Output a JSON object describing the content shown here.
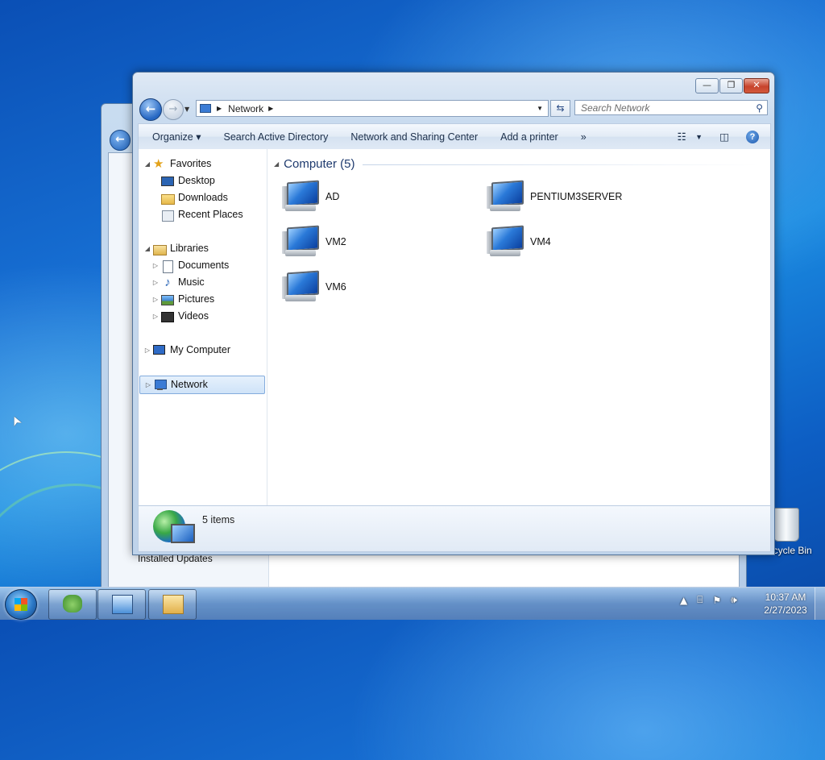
{
  "window": {
    "address": {
      "location": "Network"
    },
    "search": {
      "placeholder": "Search Network"
    }
  },
  "toolbar": {
    "organize": "Organize",
    "search_ad": "Search Active Directory",
    "network_center": "Network and Sharing Center",
    "add_printer": "Add a printer",
    "more": "»"
  },
  "navpane": {
    "favorites": "Favorites",
    "desktop": "Desktop",
    "downloads": "Downloads",
    "recent_places": "Recent Places",
    "libraries": "Libraries",
    "documents": "Documents",
    "music": "Music",
    "pictures": "Pictures",
    "videos": "Videos",
    "my_computer": "My Computer",
    "network": "Network"
  },
  "main": {
    "group_header": "Computer (5)",
    "items": [
      {
        "name": "AD"
      },
      {
        "name": "PENTIUM3SERVER"
      },
      {
        "name": "VM2"
      },
      {
        "name": "VM4"
      },
      {
        "name": "VM6"
      }
    ]
  },
  "details": {
    "count": "5 items"
  },
  "background_window": {
    "label": "Installed Updates"
  },
  "desktop": {
    "recycle_bin": "Recycle Bin"
  },
  "taskbar": {
    "time": "10:37 AM",
    "date": "2/27/2023"
  }
}
